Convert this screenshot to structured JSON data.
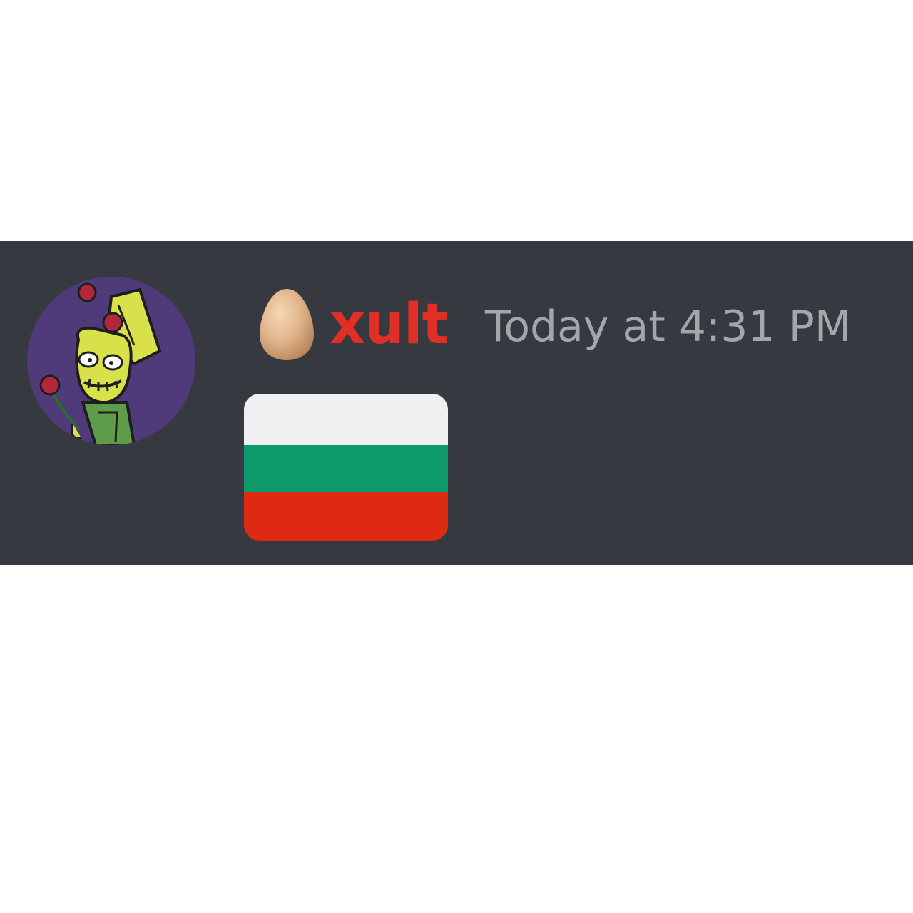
{
  "message": {
    "author": {
      "username": "xult",
      "username_color": "#e02f26",
      "badge_icon": "egg-icon",
      "avatar_icon": "cartoon-character-avatar"
    },
    "timestamp": "Today at 4:31 PM",
    "content_emoji": "flag-bulgaria-emoji"
  },
  "colors": {
    "background": "#36393f",
    "timestamp": "#a3a6aa",
    "flag_white": "#eef0f1",
    "flag_green": "#0d9a6a",
    "flag_red": "#de2a12"
  }
}
